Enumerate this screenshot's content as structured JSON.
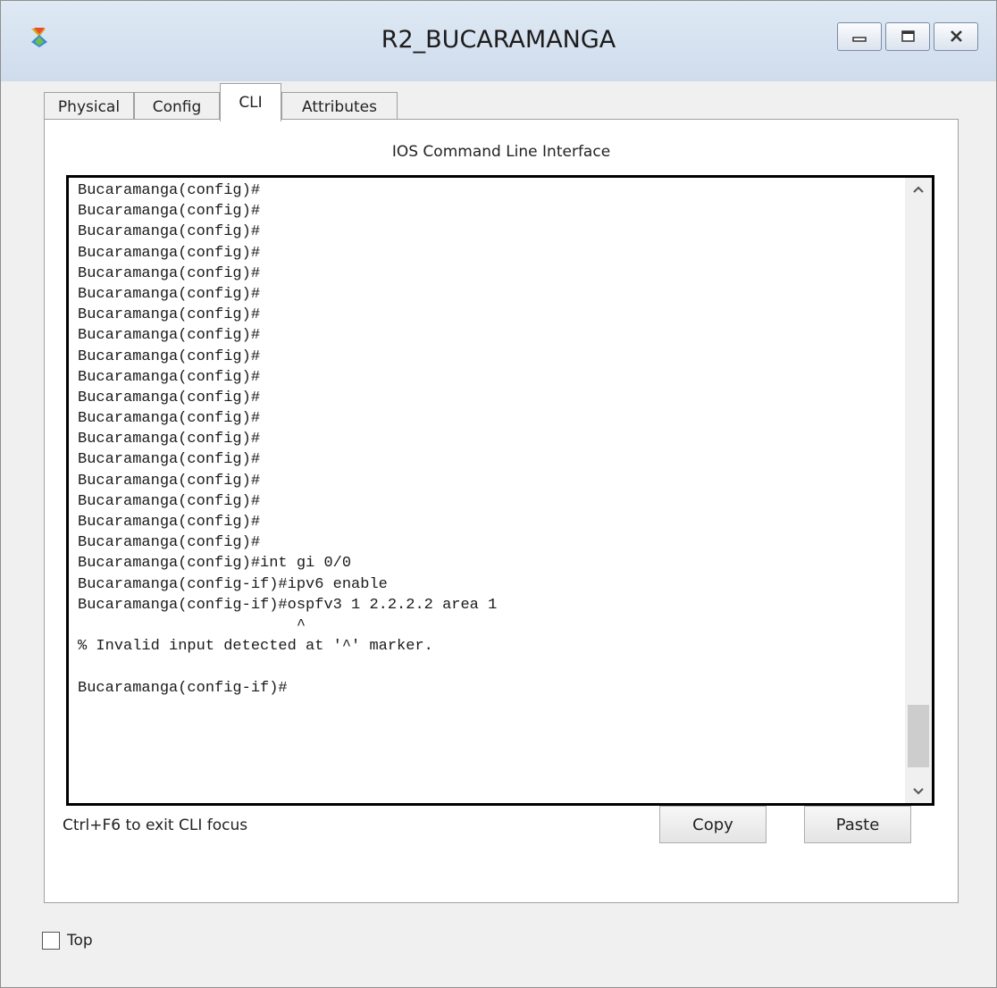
{
  "window": {
    "title": "R2_BUCARAMANGA"
  },
  "tabs": [
    {
      "label": "Physical",
      "active": false
    },
    {
      "label": "Config",
      "active": false
    },
    {
      "label": "CLI",
      "active": true
    },
    {
      "label": "Attributes",
      "active": false
    }
  ],
  "panel": {
    "title": "IOS Command Line Interface"
  },
  "terminal": {
    "lines": [
      "Bucaramanga(config)#",
      "Bucaramanga(config)#",
      "Bucaramanga(config)#",
      "Bucaramanga(config)#",
      "Bucaramanga(config)#",
      "Bucaramanga(config)#",
      "Bucaramanga(config)#",
      "Bucaramanga(config)#",
      "Bucaramanga(config)#",
      "Bucaramanga(config)#",
      "Bucaramanga(config)#",
      "Bucaramanga(config)#",
      "Bucaramanga(config)#",
      "Bucaramanga(config)#",
      "Bucaramanga(config)#",
      "Bucaramanga(config)#",
      "Bucaramanga(config)#",
      "Bucaramanga(config)#",
      "Bucaramanga(config)#int gi 0/0",
      "Bucaramanga(config-if)#ipv6 enable",
      "Bucaramanga(config-if)#ospfv3 1 2.2.2.2 area 1",
      "                        ^",
      "% Invalid input detected at '^' marker.",
      "",
      "Bucaramanga(config-if)#"
    ]
  },
  "footer": {
    "hint": "Ctrl+F6 to exit CLI focus",
    "copy_label": "Copy",
    "paste_label": "Paste"
  },
  "top_checkbox": {
    "label": "Top",
    "checked": false
  }
}
